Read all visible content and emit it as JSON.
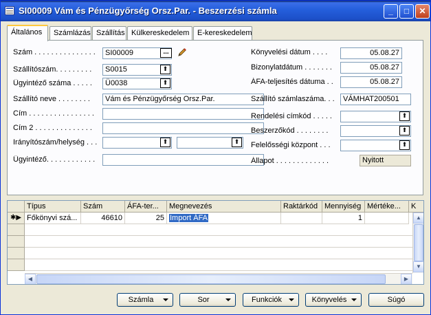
{
  "window": {
    "title": "SI00009 Vám és Pénzügyőrség Orsz.Par. - Beszerzési számla",
    "minimize_glyph": "_",
    "maximize_glyph": "□",
    "close_glyph": "✕"
  },
  "tabs": [
    {
      "label": "Általános",
      "active": true
    },
    {
      "label": "Számlázás",
      "active": false
    },
    {
      "label": "Szállítás",
      "active": false
    },
    {
      "label": "Külkereskedelem",
      "active": false
    },
    {
      "label": "E-kereskedelem",
      "active": false
    }
  ],
  "left_fields": {
    "szam": {
      "label": "Szám . . . . . . . . . . . . . . .",
      "value": "SI00009"
    },
    "szallitoszam": {
      "label": "Szállítószám. . . . . . . . .",
      "value": "S0015"
    },
    "ugyintezo_szama": {
      "label": "Ügyintéző száma . . . . .",
      "value": "Ü0038"
    },
    "szallito_neve": {
      "label": "Szállító neve . . . . . . . .",
      "value": "Vám és Pénzügyőrség Orsz.Par."
    },
    "cim": {
      "label": "Cím . . . . . . . . . . . . . . . .",
      "value": ""
    },
    "cim2": {
      "label": "Cím 2 . . . . . . . . . . . . . .",
      "value": ""
    },
    "iranyitoszam": {
      "label": "Irányítószám/helység . . .",
      "value": "",
      "value2": ""
    },
    "ugyintezo": {
      "label": "Ügyintéző. . . . . . . . . . . .",
      "value": ""
    }
  },
  "right_fields": {
    "konyvelesi_datum": {
      "label": "Könyvelési dátum . . . .",
      "value": "05.08.27"
    },
    "bizonylatdatum": {
      "label": "Bizonylatdátum . . . . . . .",
      "value": "05.08.27"
    },
    "afa_teljesites": {
      "label": "ÁFA-teljesítés dátuma . .",
      "value": "05.08.27"
    },
    "szallito_szamlaszama": {
      "label": "Szállító számlaszáma. . .",
      "value": "VÁMHAT200501"
    },
    "rendelesi_cimkod": {
      "label": "Rendelési címkód . . . . .",
      "value": ""
    },
    "beszerzokod": {
      "label": "Beszerzőkód . . . . . . . .",
      "value": ""
    },
    "felelossegi_kozpont": {
      "label": "Felelősségi központ . . .",
      "value": ""
    },
    "allapot": {
      "label": "Állapot . . . . . . . . . . . . .",
      "value": "Nyitott"
    }
  },
  "lines": {
    "columns": [
      "Típus",
      "Szám",
      "ÁFA-ter...",
      "Megnevezés",
      "Raktárkód",
      "Mennyiség",
      "Mértéke...",
      "K"
    ],
    "rows": [
      {
        "marker": "✱▶",
        "tipus": "Főkönyvi szá...",
        "szam": "46610",
        "afa": "25",
        "megnevezes": "Import ÁFA",
        "raktarkod": "",
        "mennyiseg": "1",
        "mertekegyseg": ""
      }
    ]
  },
  "buttons": {
    "szamla": "Számla",
    "sor": "Sor",
    "funkciok": "Funkciók",
    "konyveles": "Könyvelés",
    "sugo": "Súgó"
  }
}
